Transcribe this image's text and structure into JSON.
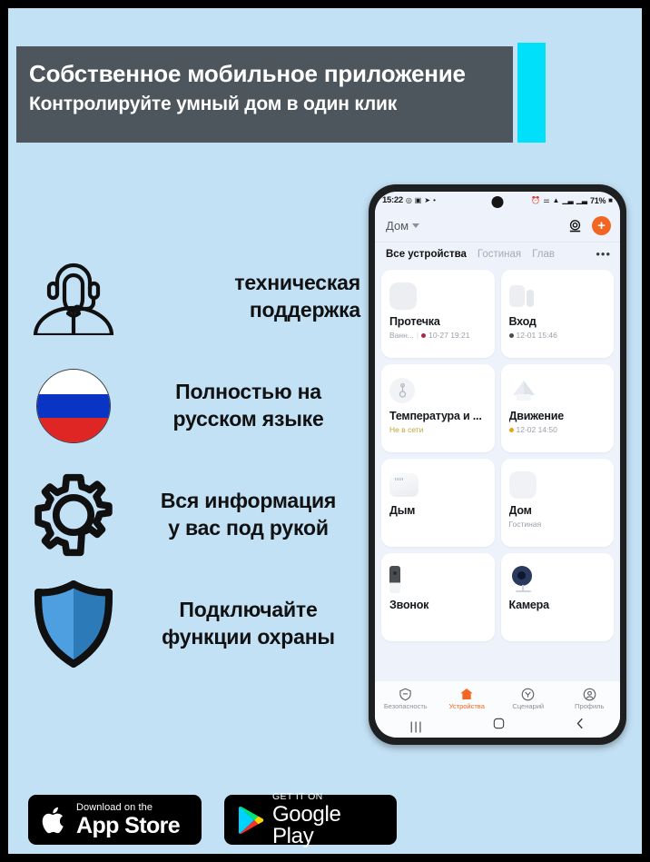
{
  "colors": {
    "background": "#c3e1f5",
    "banner_bg": "#4c565c",
    "accent_cyan": "#00e0fb",
    "accent_orange": "#f26522",
    "shield_light": "#4d9fe0",
    "shield_dark": "#2c7bb8",
    "flag_white": "#ffffff",
    "flag_blue": "#0a34c4",
    "flag_red": "#e02525",
    "offline_text": "#c2a63a"
  },
  "banner": {
    "title": "Собственное мобильное приложение",
    "subtitle": "Контролируйте умный дом в один клик"
  },
  "features": [
    {
      "icon": "headset-support-icon",
      "line1": "техническая",
      "line2": "поддержка"
    },
    {
      "icon": "russian-flag-icon",
      "line1": "Полностью на",
      "line2": "русском языке"
    },
    {
      "icon": "gear-icon",
      "line1": "Вся информация",
      "line2": "у вас под рукой"
    },
    {
      "icon": "shield-icon",
      "line1": "Подключайте",
      "line2": "функции охраны"
    }
  ],
  "phone": {
    "statusbar": {
      "time": "15:22",
      "left_icons": [
        "ring-icon",
        "screenshot-icon",
        "telegram-icon",
        "dot-icon"
      ],
      "right_icons": [
        "alarm-icon",
        "vpn-icon",
        "wifi-icon",
        "signal-icon",
        "signal2-icon"
      ],
      "battery": "71%"
    },
    "header": {
      "home_label": "Дом",
      "camera_icon": "camera-icon",
      "add_label": "+"
    },
    "tabs": [
      {
        "label": "Все устройства",
        "active": true
      },
      {
        "label": "Гостиная",
        "active": false
      },
      {
        "label": "Глав",
        "active": false
      }
    ],
    "tabs_more": "•••",
    "devices": [
      {
        "name": "Протечка",
        "room": "Ванн...",
        "time": "10-27 19:21",
        "dot": "red",
        "art": "leak-sensor-icon"
      },
      {
        "name": "Вход",
        "room": "",
        "time": "12-01 15:46",
        "dot": "dark",
        "art": "door-sensor-icon"
      },
      {
        "name": "Температура и ...",
        "room": "",
        "time": "",
        "status": "Не в сети",
        "art": "temp-sensor-icon"
      },
      {
        "name": "Движение",
        "room": "",
        "time": "12-02 14:50",
        "dot": "amber",
        "art": "motion-sensor-icon"
      },
      {
        "name": "Дым",
        "room": "",
        "time": "",
        "art": "smoke-sensor-icon"
      },
      {
        "name": "Дом",
        "room": "Гостиная",
        "time": "",
        "art": "hub-icon"
      },
      {
        "name": "Звонок",
        "room": "",
        "time": "",
        "art": "doorbell-icon"
      },
      {
        "name": "Камера",
        "room": "",
        "time": "",
        "art": "ip-camera-icon"
      }
    ],
    "bottom_nav": [
      {
        "label": "Безопасность",
        "icon": "shield-minus-icon",
        "active": false
      },
      {
        "label": "Устройства",
        "icon": "home-icon",
        "active": true
      },
      {
        "label": "Сценарий",
        "icon": "scenario-icon",
        "active": false
      },
      {
        "label": "Профиль",
        "icon": "profile-icon",
        "active": false
      }
    ],
    "system_bar": {
      "recents": "|||",
      "home": "home-square-icon",
      "back": "back-chevron-icon"
    }
  },
  "badges": {
    "apple": {
      "small": "Download on the",
      "big": "App Store",
      "icon": "apple-icon"
    },
    "google": {
      "small": "GET IT ON",
      "big": "Google Play",
      "icon": "google-play-icon"
    }
  }
}
